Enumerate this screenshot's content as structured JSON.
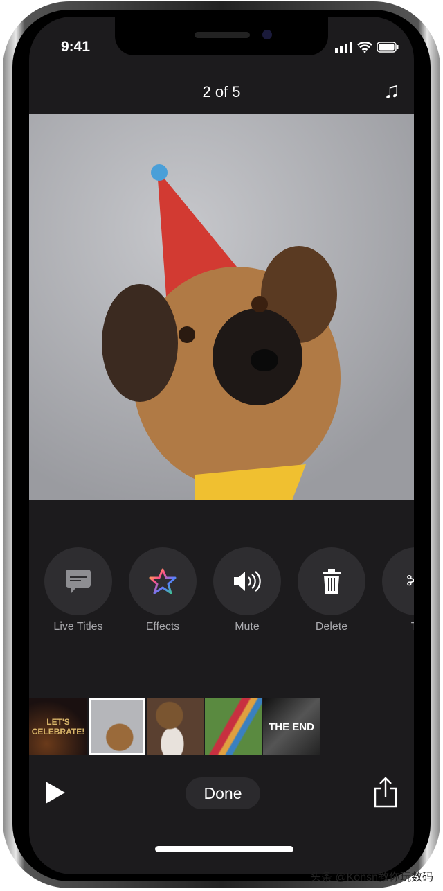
{
  "status_bar": {
    "time": "9:41"
  },
  "header": {
    "title": "2 of 5",
    "music_icon": "music-note-icon"
  },
  "tools": [
    {
      "label": "Live Titles",
      "icon": "speech-bubble-icon"
    },
    {
      "label": "Effects",
      "icon": "star-icon"
    },
    {
      "label": "Mute",
      "icon": "speaker-icon"
    },
    {
      "label": "Delete",
      "icon": "trash-icon"
    },
    {
      "label": "Tr",
      "icon": "scissors-icon"
    }
  ],
  "clips": [
    {
      "text": "LET'S CELEBRATE!"
    },
    {
      "text": "",
      "selected": true
    },
    {
      "text": ""
    },
    {
      "text": ""
    },
    {
      "text": "THE END"
    }
  ],
  "footer": {
    "done": "Done"
  },
  "watermark": "头条 @Konsn教你玩数码"
}
